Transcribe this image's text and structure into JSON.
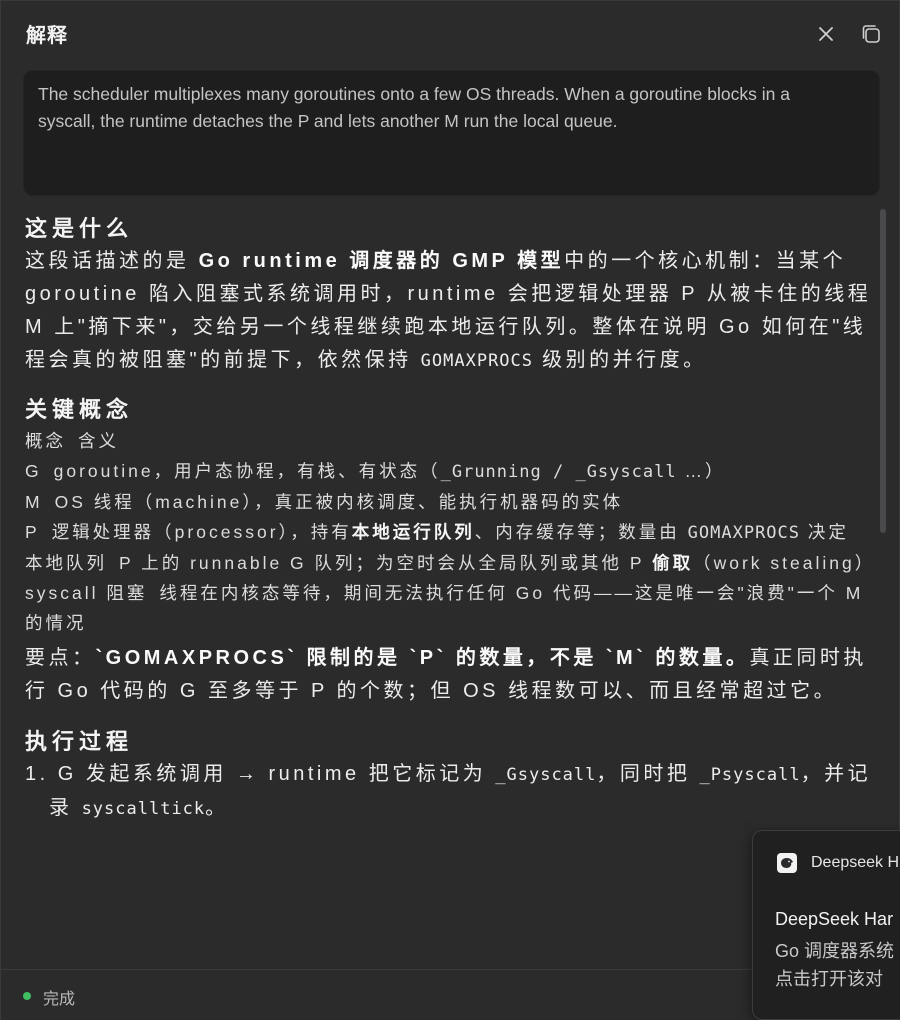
{
  "header": {
    "title": "解释"
  },
  "source": {
    "text": "The scheduler multiplexes many goroutines onto a few OS threads. When a goroutine blocks in a syscall, the runtime detaches the P and lets another M run the local queue."
  },
  "sections": {
    "what": {
      "heading": "这是什么",
      "p1": "这段话描述的是 ",
      "bold1": "Go runtime 调度器的 GMP 模型",
      "p2": "中的一个核心机制：当某个 goroutine 陷入阻塞式系统调用时，runtime 会把逻辑处理器 P 从被卡住的线程 M 上\"摘下来\"，交给另一个线程继续跑本地运行队列。整体在说明 Go 如何在\"线程会真的被阻塞\"的前提下，依然保持 ",
      "code1": "GOMAXPROCS",
      "p3": " 级别的并行度。"
    },
    "concepts": {
      "heading": "关键概念",
      "header_col1": "概念",
      "header_col2": "含义",
      "row_g_key": "G",
      "row_g_a": "goroutine，用户态协程，有栈、有状态（",
      "row_g_code1": "_Grunning",
      "row_g_sep": " / ",
      "row_g_code2": "_Gsyscall",
      "row_g_b": " …）",
      "row_m_key": "M",
      "row_m_val": "OS 线程（machine），真正被内核调度、能执行机器码的实体",
      "row_p_key": "P",
      "row_p_a": "逻辑处理器（processor），持有",
      "row_p_bold": "本地运行队列",
      "row_p_b": "、内存缓存等；数量由 ",
      "row_p_code": "GOMAXPROCS",
      "row_p_c": " 决定",
      "row_q_key": "本地队列",
      "row_q_a": "P 上的 runnable G 队列；为空时会从全局队列或其他 P ",
      "row_q_bold": "偷取",
      "row_q_b": "（work stealing）",
      "row_s_key": "syscall 阻塞",
      "row_s_val": "线程在内核态等待，期间无法执行任何 Go 代码——这是唯一会\"浪费\"一个 M 的情况"
    },
    "keypoint": {
      "label": "要点：",
      "bold": "`GOMAXPROCS` 限制的是 `P` 的数量，不是 `M` 的数量。",
      "rest": "真正同时执行 Go 代码的 G 至多等于 P 的个数；但 OS 线程数可以、而且经常超过它。"
    },
    "process": {
      "heading": "执行过程",
      "step1_a": "1. G 发起系统调用 → runtime 把它标记为 ",
      "step1_code1": "_Gsyscall",
      "step1_b": "，同时把 ",
      "step1_code2": "_Psyscall",
      "step1_c": "，并记录 ",
      "step1_code3": "syscalltick",
      "step1_d": "。"
    }
  },
  "status": {
    "text": "完成",
    "color": "#3fbf62"
  },
  "toast": {
    "app": "Deepseek H",
    "title": "DeepSeek Har",
    "line1": "Go 调度器系统",
    "line2": "点击打开该对"
  }
}
